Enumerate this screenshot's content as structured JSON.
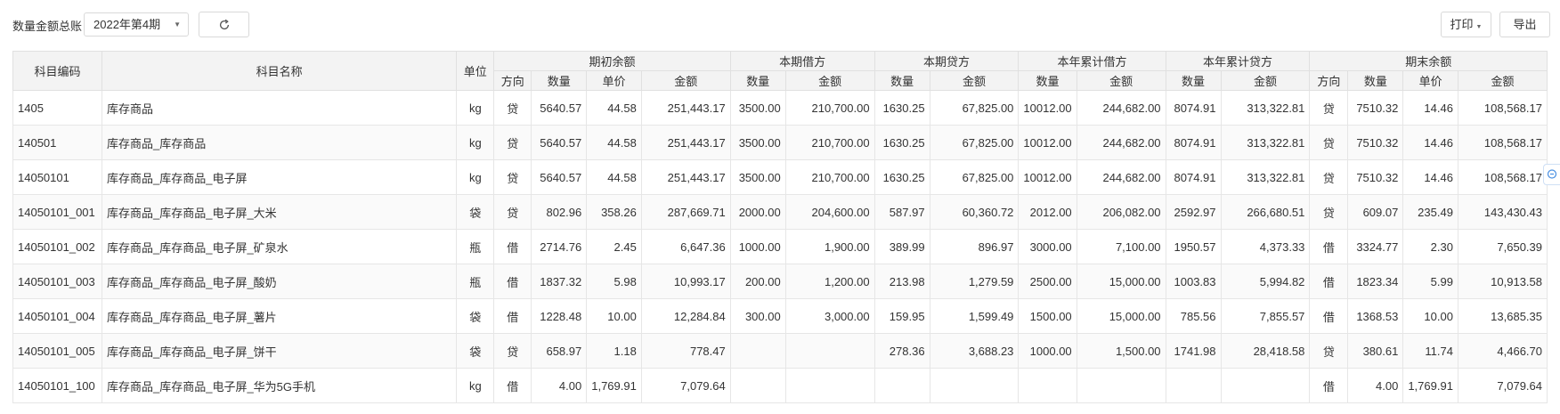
{
  "toolbar": {
    "label": "数量金额总账",
    "period": "2022年第4期",
    "print_label": "打印",
    "export_label": "导出"
  },
  "headers": {
    "code": "科目编码",
    "name": "科目名称",
    "unit": "单位",
    "groups": [
      "期初余额",
      "本期借方",
      "本期贷方",
      "本年累计借方",
      "本年累计贷方",
      "期末余额"
    ],
    "direction": "方向",
    "quantity": "数量",
    "price": "单价",
    "amount": "金额"
  },
  "rows": [
    [
      "1405",
      "库存商品",
      "kg",
      "贷",
      "5640.57",
      "44.58",
      "251,443.17",
      "3500.00",
      "210,700.00",
      "1630.25",
      "67,825.00",
      "10012.00",
      "244,682.00",
      "8074.91",
      "313,322.81",
      "贷",
      "7510.32",
      "14.46",
      "108,568.17"
    ],
    [
      "140501",
      "库存商品_库存商品",
      "kg",
      "贷",
      "5640.57",
      "44.58",
      "251,443.17",
      "3500.00",
      "210,700.00",
      "1630.25",
      "67,825.00",
      "10012.00",
      "244,682.00",
      "8074.91",
      "313,322.81",
      "贷",
      "7510.32",
      "14.46",
      "108,568.17"
    ],
    [
      "14050101",
      "库存商品_库存商品_电子屏",
      "kg",
      "贷",
      "5640.57",
      "44.58",
      "251,443.17",
      "3500.00",
      "210,700.00",
      "1630.25",
      "67,825.00",
      "10012.00",
      "244,682.00",
      "8074.91",
      "313,322.81",
      "贷",
      "7510.32",
      "14.46",
      "108,568.17"
    ],
    [
      "14050101_001",
      "库存商品_库存商品_电子屏_大米",
      "袋",
      "贷",
      "802.96",
      "358.26",
      "287,669.71",
      "2000.00",
      "204,600.00",
      "587.97",
      "60,360.72",
      "2012.00",
      "206,082.00",
      "2592.97",
      "266,680.51",
      "贷",
      "609.07",
      "235.49",
      "143,430.43"
    ],
    [
      "14050101_002",
      "库存商品_库存商品_电子屏_矿泉水",
      "瓶",
      "借",
      "2714.76",
      "2.45",
      "6,647.36",
      "1000.00",
      "1,900.00",
      "389.99",
      "896.97",
      "3000.00",
      "7,100.00",
      "1950.57",
      "4,373.33",
      "借",
      "3324.77",
      "2.30",
      "7,650.39"
    ],
    [
      "14050101_003",
      "库存商品_库存商品_电子屏_酸奶",
      "瓶",
      "借",
      "1837.32",
      "5.98",
      "10,993.17",
      "200.00",
      "1,200.00",
      "213.98",
      "1,279.59",
      "2500.00",
      "15,000.00",
      "1003.83",
      "5,994.82",
      "借",
      "1823.34",
      "5.99",
      "10,913.58"
    ],
    [
      "14050101_004",
      "库存商品_库存商品_电子屏_薯片",
      "袋",
      "借",
      "1228.48",
      "10.00",
      "12,284.84",
      "300.00",
      "3,000.00",
      "159.95",
      "1,599.49",
      "1500.00",
      "15,000.00",
      "785.56",
      "7,855.57",
      "借",
      "1368.53",
      "10.00",
      "13,685.35"
    ],
    [
      "14050101_005",
      "库存商品_库存商品_电子屏_饼干",
      "袋",
      "贷",
      "658.97",
      "1.18",
      "778.47",
      "",
      "",
      "278.36",
      "3,688.23",
      "1000.00",
      "1,500.00",
      "1741.98",
      "28,418.58",
      "贷",
      "380.61",
      "11.74",
      "4,466.70"
    ],
    [
      "14050101_100",
      "库存商品_库存商品_电子屏_华为5G手机",
      "kg",
      "借",
      "4.00",
      "1,769.91",
      "7,079.64",
      "",
      "",
      "",
      "",
      "",
      "",
      "",
      "",
      "借",
      "4.00",
      "1,769.91",
      "7,079.64"
    ]
  ]
}
